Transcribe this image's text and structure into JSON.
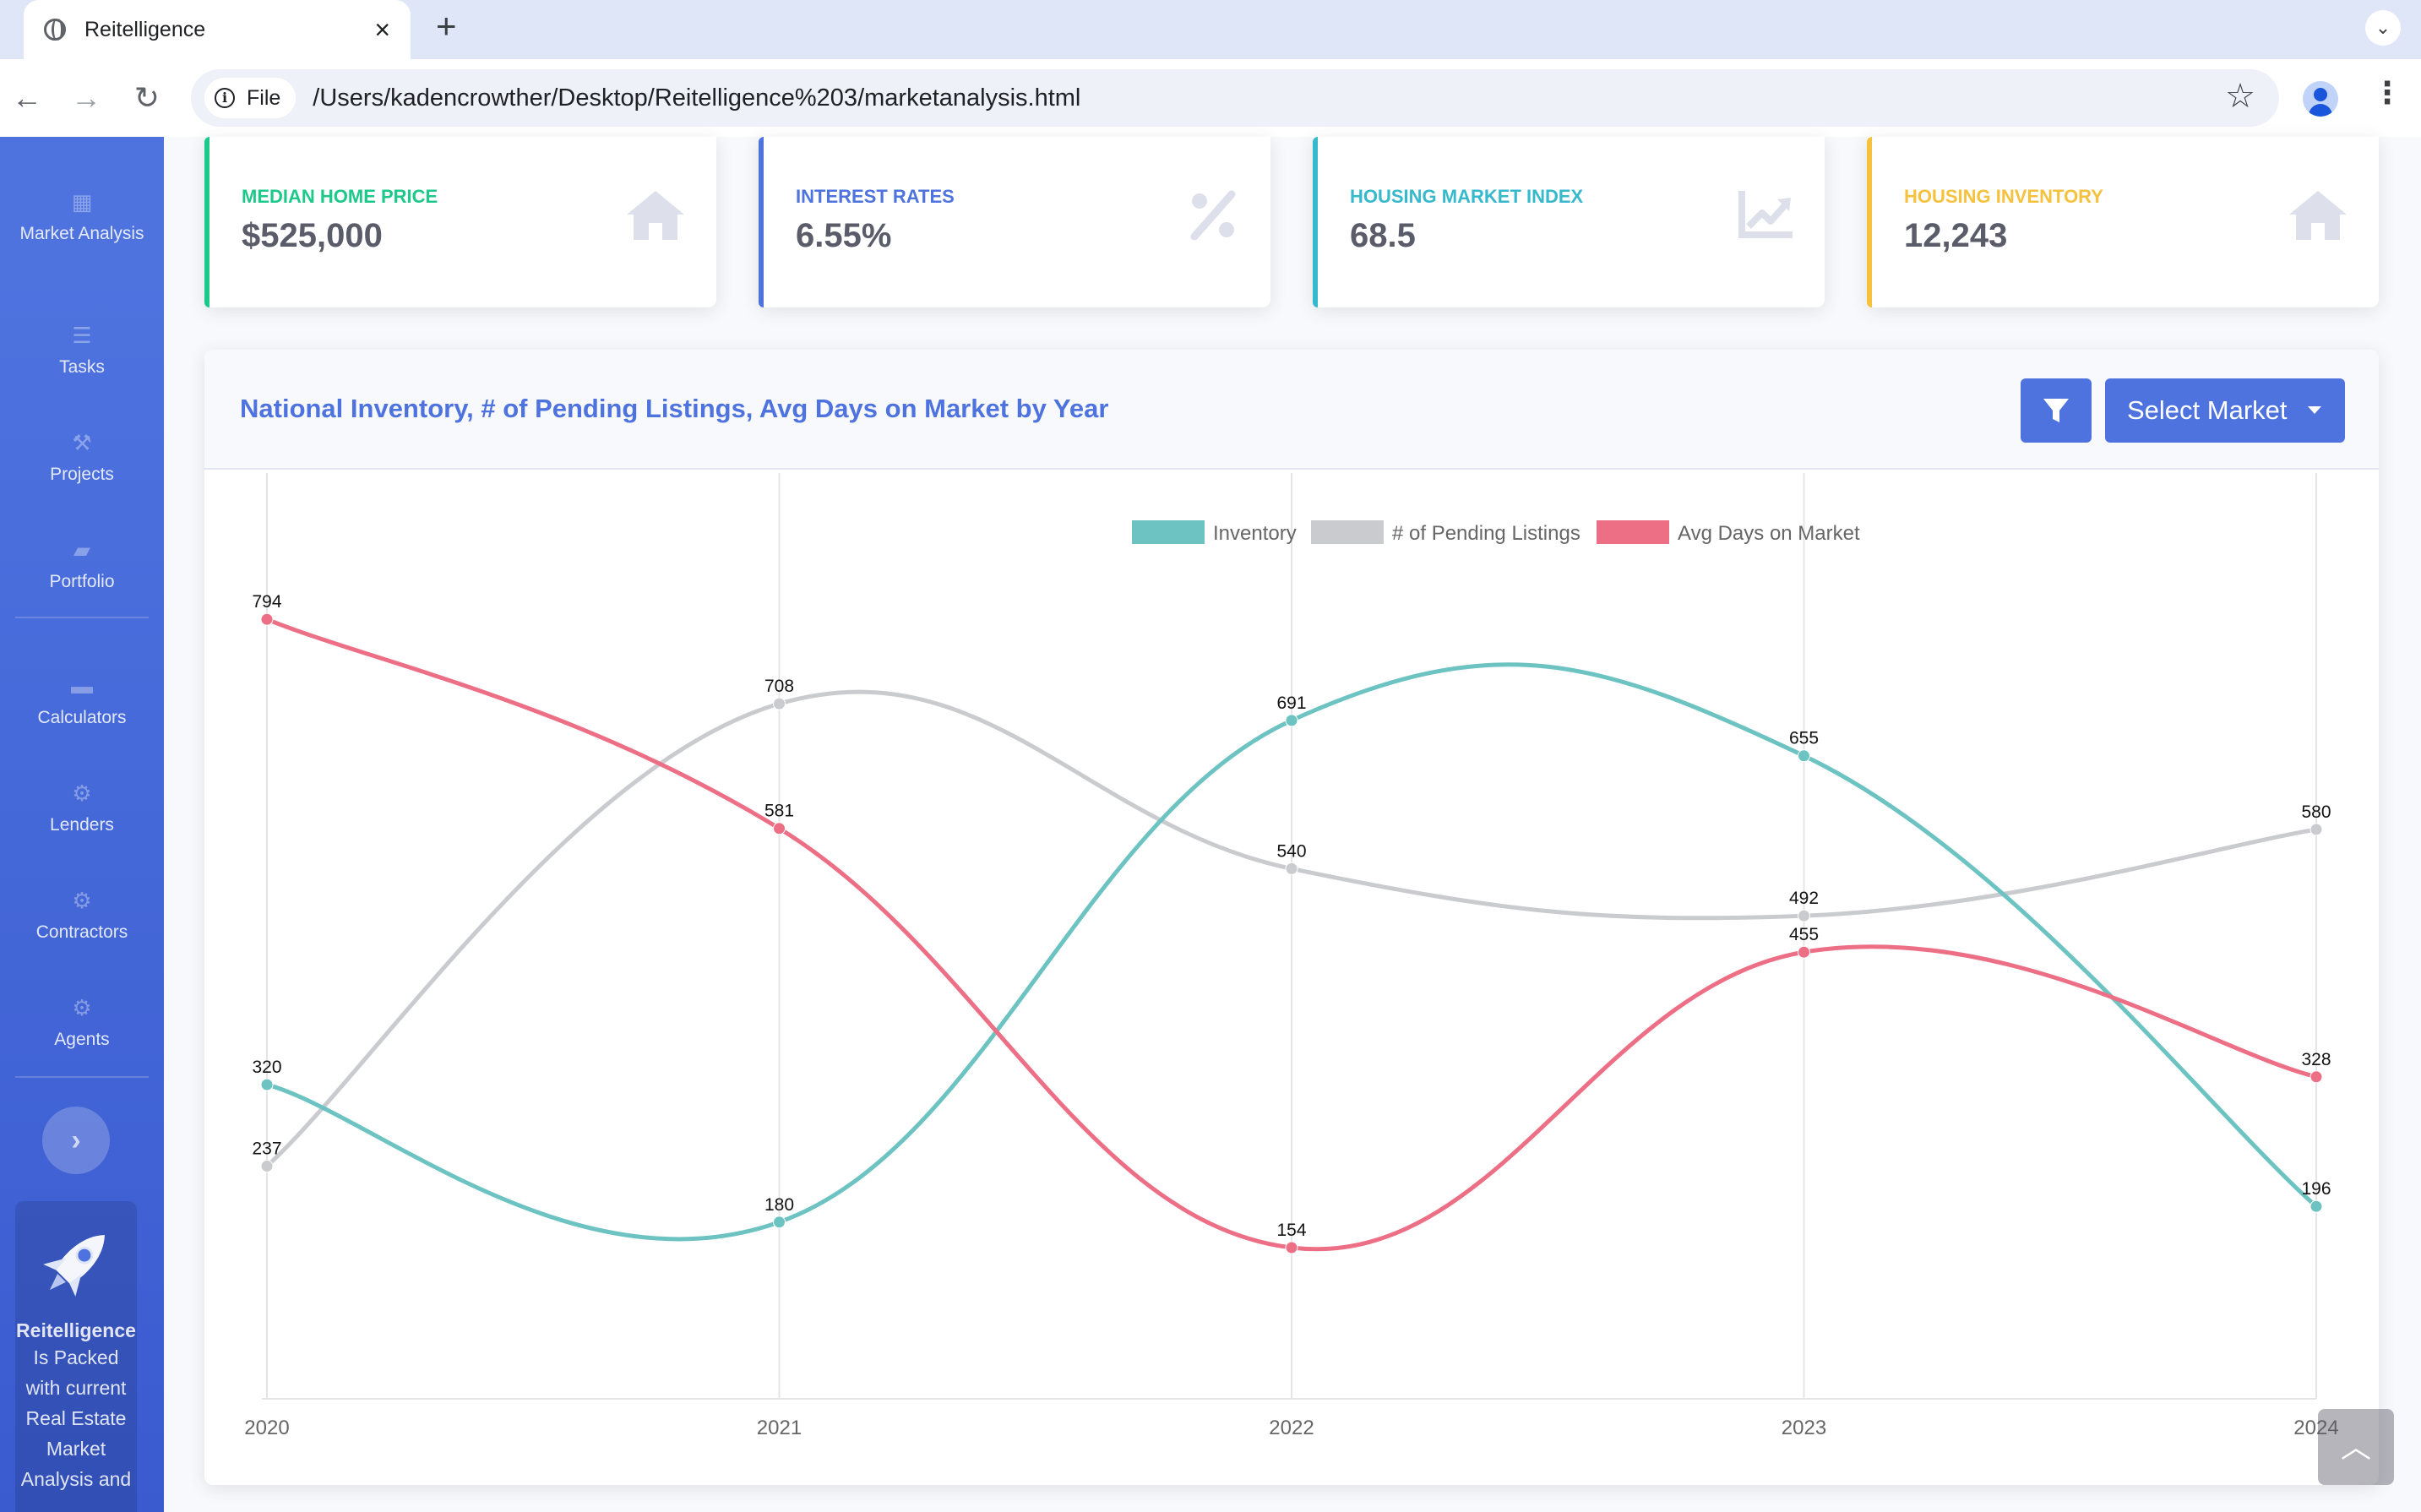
{
  "browser": {
    "tab_title": "Reitelligence",
    "file_chip": "File",
    "url": "/Users/kadencrowther/Desktop/Reitelligence%203/marketanalysis.html"
  },
  "sidebar": {
    "items": [
      {
        "label": "Market Analysis",
        "icon": "table-icon"
      },
      {
        "label": "Tasks",
        "icon": "list-icon"
      },
      {
        "label": "Projects",
        "icon": "wrench-icon"
      },
      {
        "label": "Portfolio",
        "icon": "folder-open-icon"
      },
      {
        "label": "Calculators",
        "icon": "folder-icon"
      },
      {
        "label": "Lenders",
        "icon": "gear-icon"
      },
      {
        "label": "Contractors",
        "icon": "gear-icon"
      },
      {
        "label": "Agents",
        "icon": "gear-icon"
      }
    ],
    "promo_title": "Reitelligence",
    "promo_text": "Is Packed with current Real Estate Market Analysis and"
  },
  "cards": [
    {
      "label": "Median Home Price",
      "value": "$525,000",
      "color": "#1cc88a",
      "icon": "home-icon"
    },
    {
      "label": "Interest Rates",
      "value": "6.55%",
      "color": "#4e73df",
      "icon": "percent-icon"
    },
    {
      "label": "Housing Market Index",
      "value": "68.5",
      "color": "#36b9cc",
      "icon": "chart-line-icon"
    },
    {
      "label": "Housing Inventory",
      "value": "12,243",
      "color": "#f6c23e",
      "icon": "home-icon"
    }
  ],
  "panel": {
    "title": "National Inventory, # of Pending Listings, Avg Days on Market by Year",
    "select_market": "Select Market"
  },
  "chart_data": {
    "type": "line",
    "title": "National Inventory, # of Pending Listings, Avg Days on Market by Year",
    "categories": [
      "2020",
      "2021",
      "2022",
      "2023",
      "2024"
    ],
    "series": [
      {
        "name": "Inventory",
        "values": [
          320,
          180,
          691,
          655,
          196
        ],
        "color": "#6cc3c2"
      },
      {
        "name": "# of Pending Listings",
        "values": [
          237,
          708,
          540,
          492,
          580
        ],
        "color": "#c9cbcf"
      },
      {
        "name": "Avg Days on Market",
        "values": [
          794,
          581,
          154,
          455,
          328
        ],
        "color": "#ec6f86"
      }
    ],
    "ylim": [
      0,
      900
    ],
    "smooth": true,
    "data_labels": true,
    "legend": "top-center",
    "grid": "vertical"
  }
}
